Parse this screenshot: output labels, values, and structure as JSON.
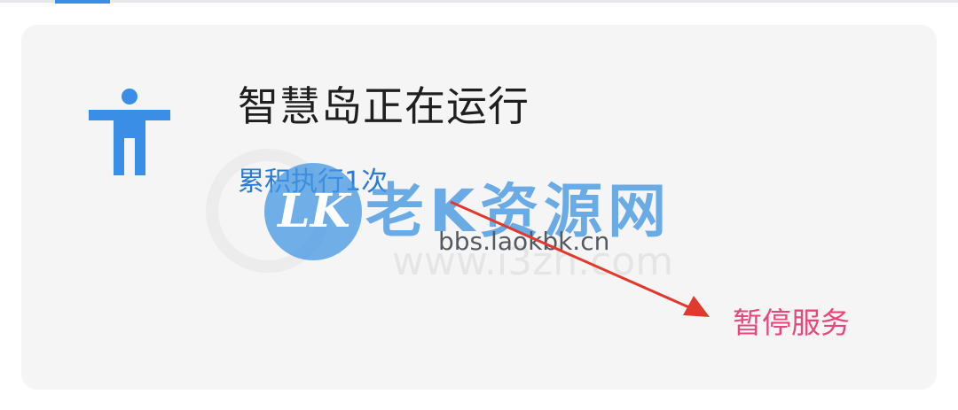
{
  "service": {
    "title": "智慧岛正在运行",
    "exec_count": "累积执行1次",
    "pause_label": "暂停服务",
    "icon": "accessibility-person-icon"
  },
  "watermark": {
    "logo_text": "LK",
    "brand": "老K资源网",
    "url": "bbs.laokbk.cn",
    "ghost_url": "www.i3zh.com"
  },
  "colors": {
    "card_bg": "#f5f5f6",
    "title": "#1f1f1f",
    "exec_count": "#2b7bd6",
    "pause": "#e8477a",
    "icon": "#3a8ee6",
    "annotation_arrow": "#e03a2f",
    "tab_indicator": "#3a8ee6"
  }
}
